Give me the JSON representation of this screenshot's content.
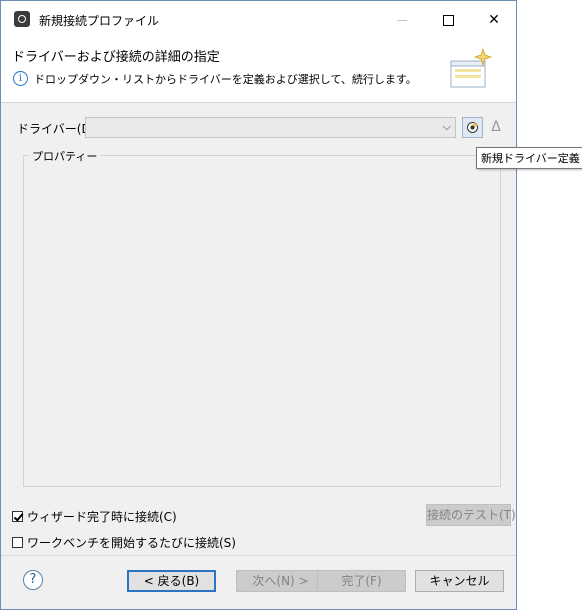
{
  "window": {
    "title": "新規接続プロファイル",
    "controls": {
      "minimize": "—",
      "maximize": "",
      "close": "✕"
    }
  },
  "header": {
    "title": "ドライバーおよび接続の詳細の指定",
    "message": "ドロップダウン・リストからドライバーを定義および選択して、続行します。",
    "info_icon": "i"
  },
  "driver": {
    "label": "ドライバー(D):",
    "value": "",
    "arrow": "⌵",
    "edit_glyph": "Δ"
  },
  "tooltip": {
    "text": "新規ドライバー定義"
  },
  "properties": {
    "label": "プロパティー"
  },
  "options": {
    "connect_on_finish": {
      "label": "ウィザード完了時に接続(C)",
      "checked": true
    },
    "connect_on_startup": {
      "label": "ワークベンチを開始するたびに接続(S)",
      "checked": false
    }
  },
  "test_button": "接続のテスト(T)",
  "buttons": {
    "help": "?",
    "back": "< 戻る(B)",
    "next": "次へ(N) >",
    "finish": "完了(F)",
    "cancel": "キャンセル"
  },
  "colors": {
    "accent": "#2d73c4",
    "window_border": "#6d8fb3",
    "dialog_bg": "#f0f0f0",
    "disabled_text": "#838383"
  }
}
